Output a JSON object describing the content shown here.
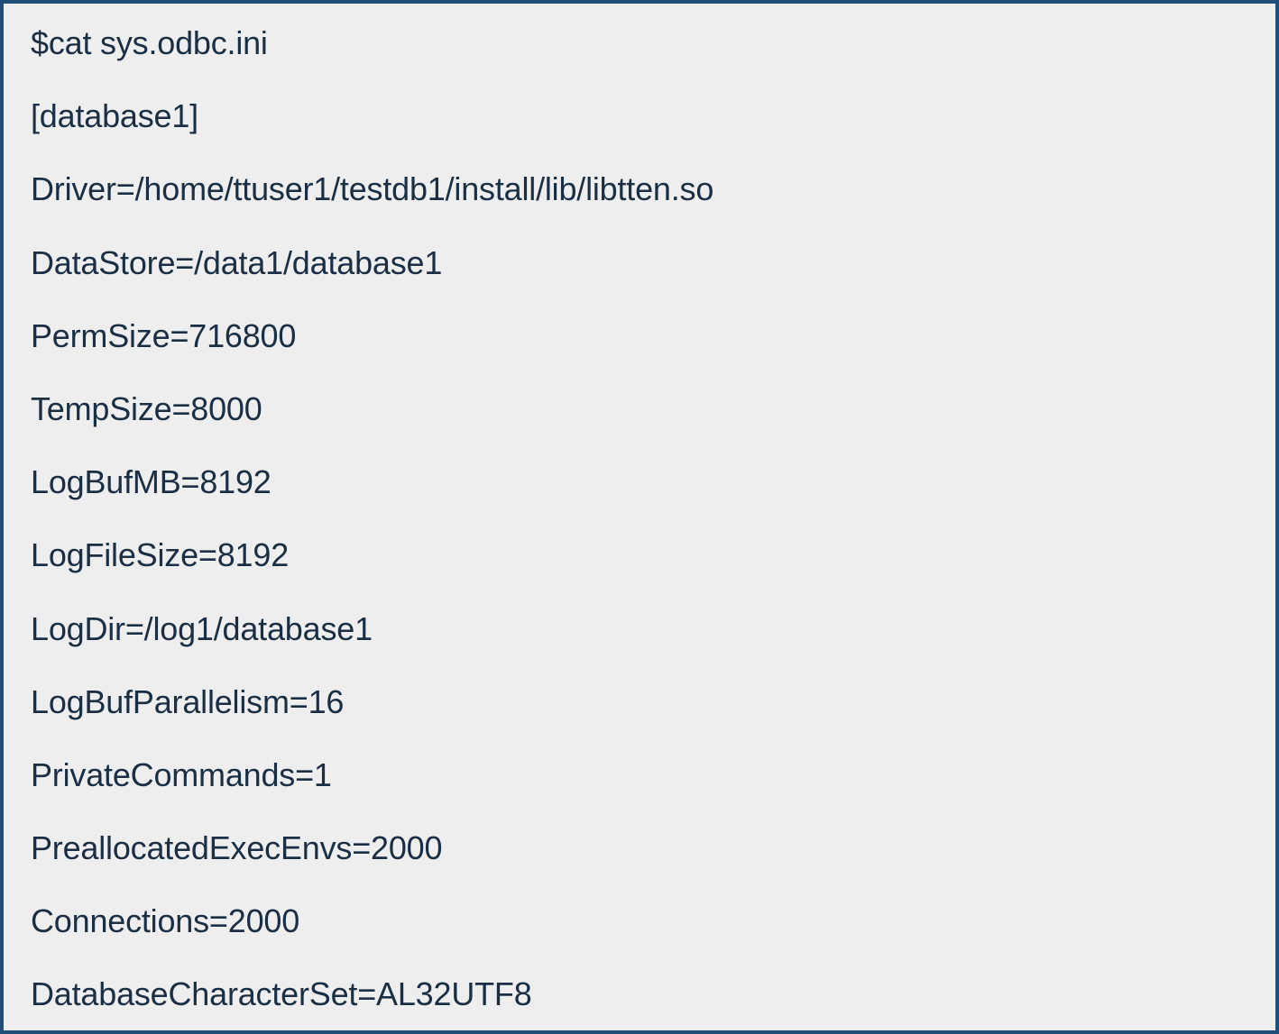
{
  "config": {
    "lines": [
      "$cat sys.odbc.ini",
      "[database1]",
      "Driver=/home/ttuser1/testdb1/install/lib/libtten.so",
      "DataStore=/data1/database1",
      "PermSize=716800",
      "TempSize=8000",
      "LogBufMB=8192",
      "LogFileSize=8192",
      "LogDir=/log1/database1",
      "LogBufParallelism=16",
      "PrivateCommands=1",
      "PreallocatedExecEnvs=2000",
      "Connections=2000"
    ],
    "last_line_pre": "DatabaseCharacterSet",
    "last_line_post": "=AL32UTF8"
  }
}
